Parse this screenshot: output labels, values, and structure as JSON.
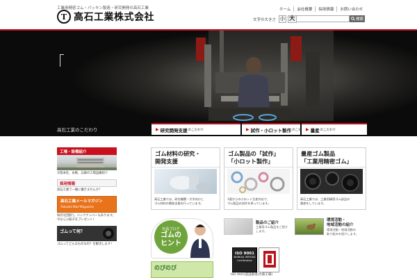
{
  "header": {
    "tagline": "工業用精密ゴム・パッキン製造・研究開発の高石工業",
    "logo_mark": "T",
    "company_name": "高石工業株式会社",
    "nav": [
      "ホーム",
      "会社概要",
      "採用情報",
      "お問い合わせ"
    ],
    "font_size_label": "文字の大きさ",
    "font_small": "小",
    "font_large": "大",
    "search_placeholder": "",
    "search_button": "検索"
  },
  "hero": {
    "title": "高石工業のこだわり",
    "tabs": [
      {
        "bold": "研究開発支援",
        "small": "のこだわり"
      },
      {
        "bold": "試作・小ロット製作",
        "small": "のこだわり"
      },
      {
        "bold": "量産",
        "small": "のこだわり"
      }
    ]
  },
  "sidebar": {
    "factory": {
      "head": "工場・設備紹介",
      "text": "大阪本社、糸数、兵庫の工場設備紹介"
    },
    "recruit": {
      "head": "採用情報",
      "text": "高石工業で一緒に働きませんか？"
    },
    "mail": {
      "title": "高石工業メールマガジン",
      "sub": "Takaishi Mail Magazine",
      "text1": "毎月1回発行。バックナンバーもあります。",
      "text2": "今なら小冊子をプレゼント！"
    },
    "gomu": {
      "title": "ゴムって何？",
      "text": "ゴムってどんなものなの？を解決します！"
    }
  },
  "cards": [
    {
      "title1": "ゴム材料の研究・",
      "title2": "開発支援",
      "text1": "高石工業では、研究機関・大学向けに",
      "text2": "ゴム材料の開発支援を行っています。"
    },
    {
      "title1": "ゴム製品の「試作」",
      "title2": "「小ロット製作」",
      "text1": "1個からの小ロット生産対応で、",
      "text2": "ゴム製品の試作を承っています。"
    },
    {
      "title1": "量産ゴム製品",
      "title2": "「工業用精密ゴム」",
      "text1": "高石工業では、工業用精密ゴム部品の",
      "text2": "量産をしています。"
    }
  ],
  "blog": {
    "line1": "社長ブログ",
    "line2a": "ゴムの",
    "line2b": "ヒント"
  },
  "nobi": {
    "text": "のびのび"
  },
  "product": {
    "title": "製品のご紹介",
    "text1": "工業用ゴム製品をご紹介",
    "text2": "します。"
  },
  "env": {
    "title1": "環境活動・",
    "title2": "地域活動の紹介",
    "text1": "環境活動・地域活動の",
    "text2": "取り組みを紹介します。"
  },
  "iso": {
    "code": "ISO 9001",
    "org": "BUREAU VERITAS",
    "cert": "Certification",
    "caption": "ISO 9001認証取得(大阪工場)"
  }
}
